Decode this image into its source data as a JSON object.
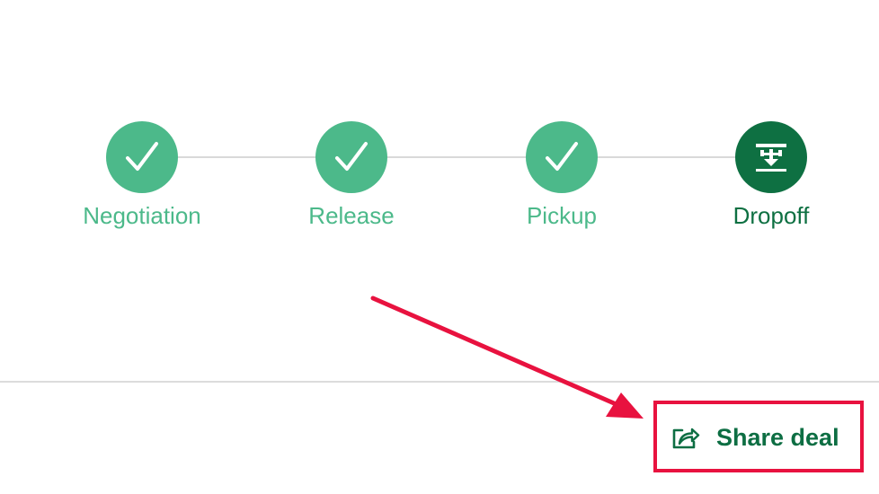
{
  "colors": {
    "completed": "#4cb98a",
    "current": "#0e7042",
    "connector": "#d9d9d9",
    "share_text": "#0d6e43",
    "highlight": "#e8123f"
  },
  "stepper": {
    "steps": [
      {
        "label": "Negotiation",
        "status": "completed",
        "icon": "check-icon"
      },
      {
        "label": "Release",
        "status": "completed",
        "icon": "check-icon"
      },
      {
        "label": "Pickup",
        "status": "completed",
        "icon": "check-icon"
      },
      {
        "label": "Dropoff",
        "status": "current",
        "icon": "dropoff-icon"
      }
    ]
  },
  "share": {
    "label": "Share deal",
    "icon": "share-icon"
  },
  "annotation": {
    "type": "arrow",
    "target": "share-button"
  }
}
